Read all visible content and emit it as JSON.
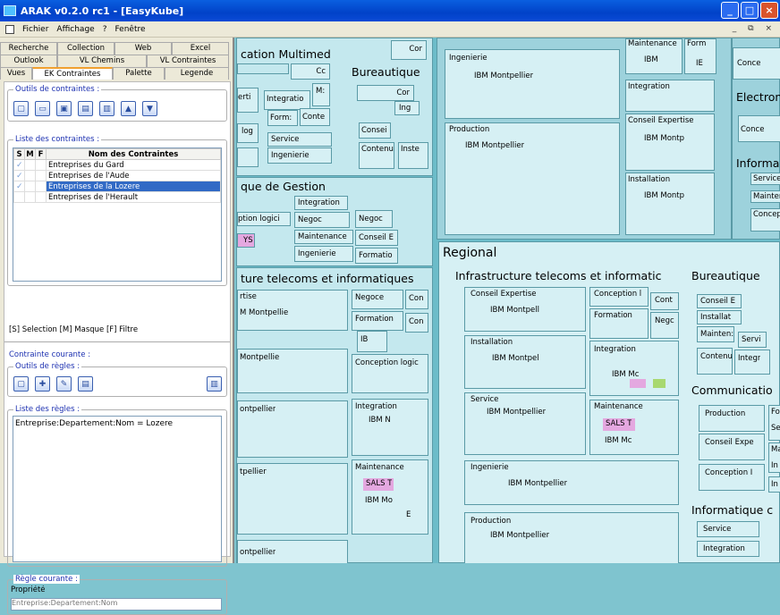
{
  "window": {
    "title": "ARAK v0.2.0 rc1 - [EasyKube]",
    "buttons": [
      "_",
      "□",
      "×"
    ]
  },
  "menu": {
    "items": [
      "Fichier",
      "Affichage",
      "?",
      "Fenêtre"
    ],
    "mdi": "_ ⧉ ×"
  },
  "tabs": {
    "row1": [
      "Recherche",
      "Collection",
      "Web",
      "Excel"
    ],
    "row2": [
      "Outlook",
      "VL Chemins",
      "VL Contraintes"
    ],
    "row3": [
      "Vues",
      "EK Contraintes",
      "Palette",
      "Legende"
    ]
  },
  "contraintes": {
    "tools_label": "Outils de contraintes :",
    "list_label": "Liste des contraintes :",
    "headers": [
      "S",
      "M",
      "F",
      "Nom des Contraintes"
    ],
    "rows": [
      {
        "s": "✓",
        "name": "Entreprises du Gard"
      },
      {
        "s": "✓",
        "name": "Entreprises de l'Aude"
      },
      {
        "s": "✓",
        "name": "Entreprises de la Lozere"
      },
      {
        "s": "",
        "name": "Entreprises de l'Herault"
      }
    ],
    "legend": "[S] Selection  [M] Masque  [F] Filtre"
  },
  "courante": {
    "label": "Contrainte courante :",
    "tools_label": "Outils de règles :",
    "rules_label": "Liste des règles :",
    "rules": [
      "Entreprise:Departement:Nom = Lozere"
    ]
  },
  "regle": {
    "label": "Règle courante :",
    "propriete": "Propriété",
    "value": "Entreprise:Departement:Nom"
  },
  "map": {
    "titles": {
      "ccm": "cation Multimed",
      "bureautique": "Bureautique",
      "gestion": "que de Gestion",
      "infra": "ture telecoms et informatiques",
      "regional": "Regional",
      "infra2": "Infrastructure telecoms et informatic",
      "bureautique2": "Bureautique",
      "communication": "Communicatio",
      "informatique": "Informatique c",
      "electron": "Electron",
      "informa": "Informa"
    },
    "labels": {
      "cor": "Cor",
      "cc": "Cc",
      "ms": "M:",
      "erti": "erti",
      "integratio": "Integratio",
      "forma": "Form:",
      "conte": "Conte",
      "log": "log",
      "service": "Service",
      "ingenierie": "Ingenierie",
      "integration": "Integration",
      "ption_logici": "ption logici",
      "maintenance": "Maintenance",
      "negoc": "Negoc",
      "conseil_e": "Conseil E",
      "formatio": "Formatio",
      "ys": "YS",
      "cor2": "Cor",
      "ing": "Ing",
      "consei": "Consei",
      "contenu": "Contenu",
      "inste": "Inste",
      "rtise": "rtise",
      "m_montpellie": "M Montpellie",
      "negoce": "Negoce",
      "con": "Con",
      "formation": "Formation",
      "ib": "IB",
      "ontpellie": "Montpellie",
      "conception_logic": "Conception logic",
      "ontpellier": "ontpellier",
      "integration2": "Integration",
      "ibm_n": "IBM N",
      "tpellier": "tpellier",
      "maintenance2": "Maintenance",
      "sals_t": "SALS T",
      "ibm_mo": "IBM Mo",
      "e": "E",
      "ontpellier2": "ontpellier",
      "ingenierie_t": "Ingenierie",
      "ibm_montpellier": "IBM Montpellier",
      "maintenance_t": "Maintenance",
      "form_t": "Form",
      "ibm_t": "IBM",
      "ie": "IE",
      "integration_t": "Integration",
      "conseil_expertise": "Conseil Expertise",
      "ibm_montp": "IBM Montp",
      "installation": "Installation",
      "ibm_montp2": "IBM Montp",
      "production": "Production",
      "ibm_montpellier2": "IBM Montpellier",
      "conce": "Conce",
      "conce2": "Conce",
      "service_r": "Service",
      "mainter": "Mainter",
      "concep": "Concep",
      "r_conseil": "Conseil Expertise",
      "r_ibm_montpell": "IBM Montpell",
      "r_conception": "Conception l",
      "r_cont": "Cont",
      "r_formation": "Formation",
      "r_negc": "Negc",
      "r_installation": "Installation",
      "r_ibm_montpel": "IBM Montpel",
      "r_integration": "Integration",
      "r_ibm_mc": "IBM Mc",
      "r_service": "Service",
      "r_ibm_montpellier": "IBM Montpellier",
      "r_maintenance": "Maintenance",
      "r_sals": "SALS T",
      "r_ibm_mc2": "IBM Mc",
      "r_ingenierie": "Ingenierie",
      "r_ibm_montpellier2": "IBM Montpellier",
      "r_production": "Production",
      "r_ibm_montpellier3": "IBM Montpellier",
      "b_conseil": "Conseil E",
      "b_installat": "Installat",
      "b_mainten": "Mainten:",
      "b_servi": "Servi",
      "b_contenu": "Contenu",
      "b_integr": "Integr",
      "c_production": "Production",
      "c_fo": "Fo",
      "c_se": "Se",
      "c_conseil": "Conseil Expe",
      "c_ma": "Ma",
      "c_in": "In",
      "c_conception": "Conception I",
      "c_in2": "In",
      "i_service": "Service",
      "i_integration": "Integration"
    }
  }
}
